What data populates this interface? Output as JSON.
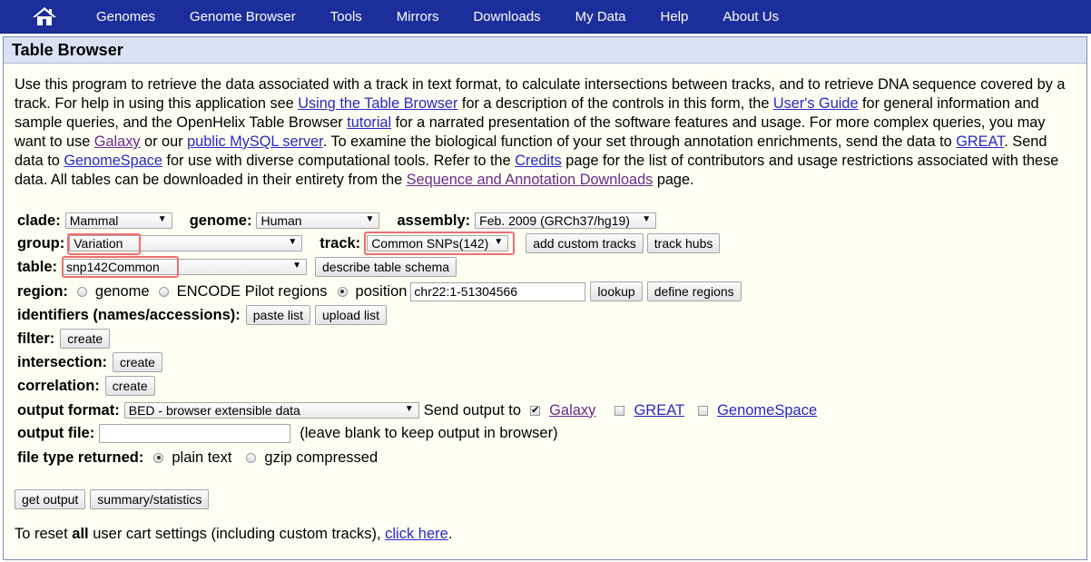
{
  "nav": {
    "items": [
      "Genomes",
      "Genome Browser",
      "Tools",
      "Mirrors",
      "Downloads",
      "My Data",
      "Help",
      "About Us"
    ],
    "home_icon": "home-icon",
    "bg_color": "#1c2e9b"
  },
  "page": {
    "title": "Table Browser"
  },
  "intro": {
    "t1": "Use this program to retrieve the data associated with a track in text format, to calculate intersections between tracks, and to retrieve DNA sequence covered by a track. For help in using this application see ",
    "link_using": "Using the Table Browser",
    "t2": " for a description of the controls in this form, the ",
    "link_guide": "User's Guide",
    "t3": " for general information and sample queries, and the OpenHelix Table Browser ",
    "link_tutorial": "tutorial",
    "t4": " for a narrated presentation of the software features and usage. For more complex queries, you may want to use ",
    "link_galaxy": "Galaxy",
    "t5": " or our ",
    "link_mysql": "public MySQL server",
    "t6": ". To examine the biological function of your set through annotation enrichments, send the data to ",
    "link_great": "GREAT",
    "t7": ". Send data to ",
    "link_genomespace": "GenomeSpace",
    "t8": " for use with diverse computational tools. Refer to the ",
    "link_credits": "Credits",
    "t9": " page for the list of contributors and usage restrictions associated with these data. All tables can be downloaded in their entirety from the ",
    "link_downloads": "Sequence and Annotation Downloads",
    "t10": " page."
  },
  "form": {
    "clade_label": "clade:",
    "clade_value": "Mammal",
    "genome_label": "genome:",
    "genome_value": "Human",
    "assembly_label": "assembly:",
    "assembly_value": "Feb. 2009 (GRCh37/hg19)",
    "group_label": "group:",
    "group_value": "Variation",
    "track_label": "track:",
    "track_value": "Common SNPs(142)",
    "add_custom_tracks": "add custom tracks",
    "track_hubs": "track hubs",
    "table_label": "table:",
    "table_value": "snp142Common",
    "describe_schema": "describe table schema",
    "region_label": "region:",
    "region_genome": "genome",
    "region_encode": "ENCODE Pilot regions",
    "region_position": "position",
    "position_value": "chr22:1-51304566",
    "lookup": "lookup",
    "define_regions": "define regions",
    "identifiers_label": "identifiers (names/accessions):",
    "paste_list": "paste list",
    "upload_list": "upload list",
    "filter_label": "filter:",
    "intersection_label": "intersection:",
    "correlation_label": "correlation:",
    "create": "create",
    "output_format_label": "output format:",
    "output_format_value": "BED - browser extensible data",
    "send_output_to": "Send output to",
    "send_galaxy": "Galaxy",
    "send_great": "GREAT",
    "send_genomespace": "GenomeSpace",
    "output_file_label": "output file:",
    "output_file_value": "",
    "output_file_hint": "(leave blank to keep output in browser)",
    "file_type_label": "file type returned:",
    "plain_text": "plain text",
    "gzip": "gzip compressed",
    "get_output": "get output",
    "summary_statistics": "summary/statistics",
    "reset_t1": "To reset ",
    "reset_bold": "all",
    "reset_t2": " user cart settings (including custom tracks), ",
    "reset_link": "click here",
    "reset_t3": "."
  },
  "colors": {
    "highlight": "#ef6f6f",
    "link": "#2828c8",
    "visited_link": "#6a2a8a",
    "title_bar": "#d9e2f5",
    "panel_bg": "#fffef3"
  }
}
